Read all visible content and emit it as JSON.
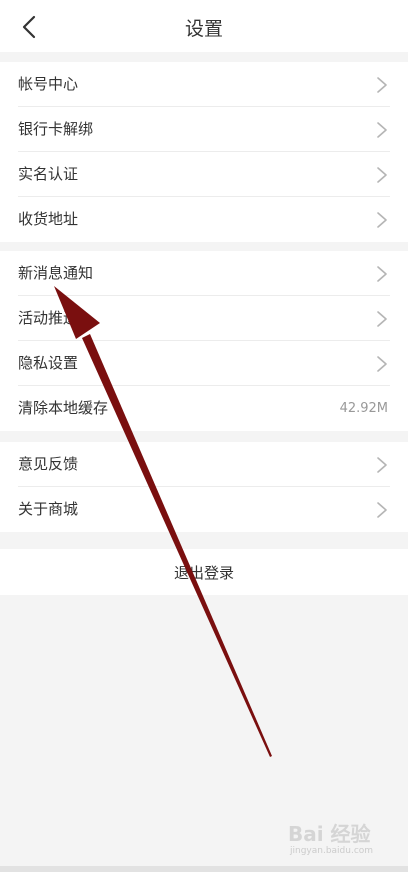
{
  "header": {
    "title": "设置",
    "back_icon": "chevron-left-icon"
  },
  "groups": [
    {
      "items": [
        {
          "label": "帐号中心",
          "icon": "chevron-right-icon"
        },
        {
          "label": "银行卡解绑",
          "icon": "chevron-right-icon"
        },
        {
          "label": "实名认证",
          "icon": "chevron-right-icon"
        },
        {
          "label": "收货地址",
          "icon": "chevron-right-icon"
        }
      ]
    },
    {
      "items": [
        {
          "label": "新消息通知",
          "icon": "chevron-right-icon"
        },
        {
          "label": "活动推送",
          "icon": "chevron-right-icon"
        },
        {
          "label": "隐私设置",
          "icon": "chevron-right-icon"
        },
        {
          "label": "清除本地缓存",
          "value": "42.92M"
        }
      ]
    },
    {
      "items": [
        {
          "label": "意见反馈",
          "icon": "chevron-right-icon"
        },
        {
          "label": "关于商城",
          "icon": "chevron-right-icon"
        }
      ]
    }
  ],
  "logout": {
    "label": "退出登录"
  },
  "annotation": {
    "arrow_color": "#7a0f0f"
  },
  "watermark": {
    "brand": "Bai 经验",
    "url": "jingyan.baidu.com"
  }
}
